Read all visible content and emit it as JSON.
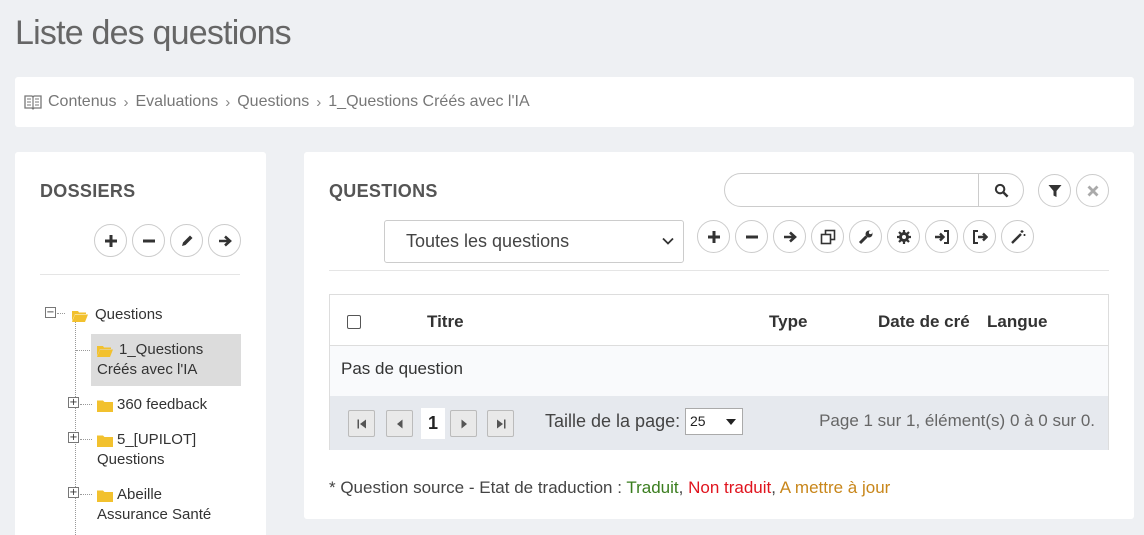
{
  "page": {
    "title": "Liste des questions"
  },
  "breadcrumb": {
    "items": [
      "Contenus",
      "Evaluations",
      "Questions",
      "1_Questions Créés avec l'IA"
    ]
  },
  "folders": {
    "heading": "DOSSIERS",
    "actions": [
      "add",
      "remove",
      "edit",
      "move"
    ],
    "tree": {
      "root": "Questions",
      "selected_line1": "1_Questions",
      "selected_line2": "Créés avec l'IA",
      "item_360": "360 feedback",
      "item_upilot_line1": "5_[UPILOT]",
      "item_upilot_line2": "Questions",
      "item_abeille_line1": "Abeille",
      "item_abeille_line2": "Assurance Santé"
    }
  },
  "questions": {
    "heading": "QUESTIONS",
    "search": {
      "value": "",
      "placeholder": ""
    },
    "filter_select": "Toutes les questions",
    "toolbar": [
      "add",
      "remove",
      "move",
      "copy",
      "wrench",
      "settings",
      "import",
      "export",
      "magic"
    ],
    "grid": {
      "columns": {
        "title": "Titre",
        "type": "Type",
        "date": "Date de cré",
        "lang": "Langue"
      },
      "empty_text": "Pas de question"
    },
    "pager": {
      "current_page": "1",
      "page_size_label": "Taille de la page:",
      "page_size": "25",
      "info": "Page 1 sur 1, élément(s) 0 à 0 sur 0."
    }
  },
  "legend": {
    "prefix": "* Question source - Etat de traduction : ",
    "translated": "Traduit",
    "not_translated": "Non traduit",
    "to_update": "A mettre à jour",
    "sep": ", ",
    "colors": {
      "translated": "#3a7d1e",
      "not_translated": "#e0141e",
      "to_update": "#c8861a"
    }
  }
}
